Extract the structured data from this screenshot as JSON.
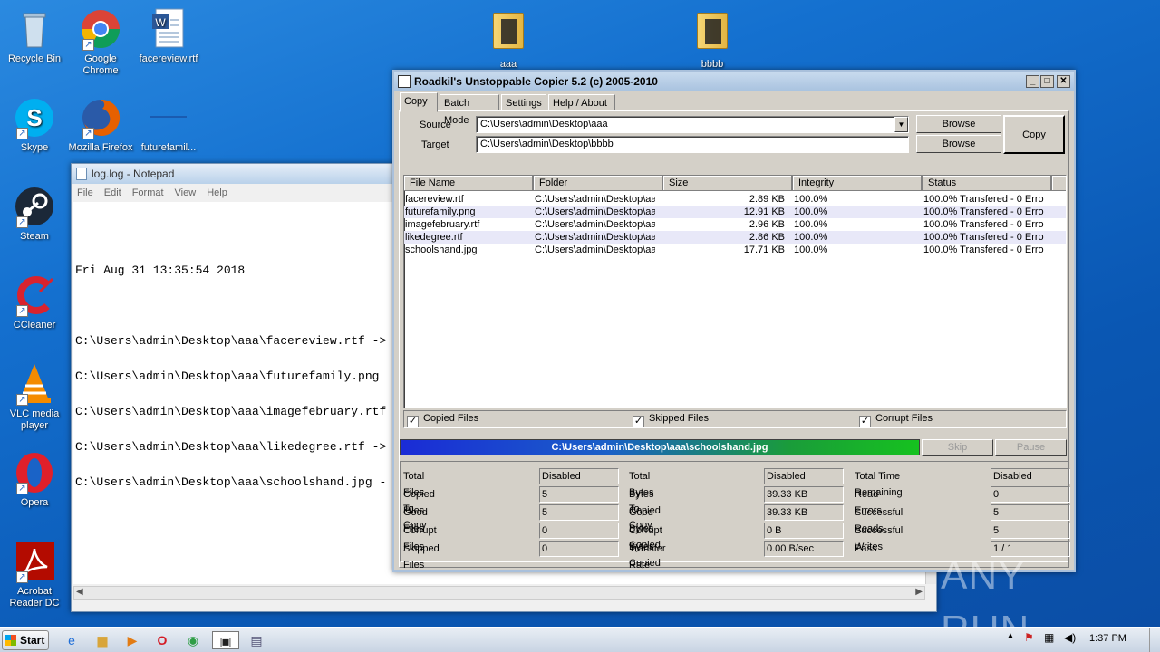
{
  "desktop_icons": [
    {
      "label": "Recycle Bin",
      "icon": "recycle-bin-icon"
    },
    {
      "label": "Google Chrome",
      "icon": "chrome-icon"
    },
    {
      "label": "facereview.rtf",
      "icon": "word-doc-icon"
    },
    {
      "label": "Skype",
      "icon": "skype-icon"
    },
    {
      "label": "Mozilla Firefox",
      "icon": "firefox-icon"
    },
    {
      "label": "futurefamil...",
      "icon": "image-file-icon"
    },
    {
      "label": "Steam",
      "icon": "steam-icon"
    },
    {
      "label": "CCleaner",
      "icon": "ccleaner-icon"
    },
    {
      "label": "VLC media player",
      "icon": "vlc-icon"
    },
    {
      "label": "Opera",
      "icon": "opera-icon"
    },
    {
      "label": "Acrobat Reader DC",
      "icon": "acrobat-icon"
    },
    {
      "label": "aaa",
      "icon": "folder-icon"
    },
    {
      "label": "bbbb",
      "icon": "folder-icon"
    }
  ],
  "notepad": {
    "title": "log.log - Notepad",
    "menu": [
      "File",
      "Edit",
      "Format",
      "View",
      "Help"
    ],
    "lines": [
      "",
      "Fri Aug 31 13:35:54 2018",
      "",
      "C:\\Users\\admin\\Desktop\\aaa\\facereview.rtf ->",
      "C:\\Users\\admin\\Desktop\\aaa\\futurefamily.png",
      "C:\\Users\\admin\\Desktop\\aaa\\imagefebruary.rtf",
      "C:\\Users\\admin\\Desktop\\aaa\\likedegree.rtf ->",
      "C:\\Users\\admin\\Desktop\\aaa\\schoolshand.jpg -"
    ]
  },
  "copier": {
    "title": "Roadkil's Unstoppable Copier 5.2 (c) 2005-2010",
    "tabs": [
      "Copy",
      "Batch Mode",
      "Settings",
      "Help / About"
    ],
    "source_label": "Source",
    "source_value": "C:\\Users\\admin\\Desktop\\aaa",
    "target_label": "Target",
    "target_value": "C:\\Users\\admin\\Desktop\\bbbb",
    "browse": "Browse",
    "copy": "Copy",
    "columns": [
      "File Name",
      "Folder",
      "Size",
      "Integrity",
      "Status"
    ],
    "rows": [
      [
        "facereview.rtf",
        "C:\\Users\\admin\\Desktop\\aaa",
        "2.89 KB",
        "100.0%",
        "100.0% Transfered - 0 Erro"
      ],
      [
        "futurefamily.png",
        "C:\\Users\\admin\\Desktop\\aaa",
        "12.91 KB",
        "100.0%",
        "100.0% Transfered - 0 Erro"
      ],
      [
        "imagefebruary.rtf",
        "C:\\Users\\admin\\Desktop\\aaa",
        "2.96 KB",
        "100.0%",
        "100.0% Transfered - 0 Erro"
      ],
      [
        "likedegree.rtf",
        "C:\\Users\\admin\\Desktop\\aaa",
        "2.86 KB",
        "100.0%",
        "100.0% Transfered - 0 Erro"
      ],
      [
        "schoolshand.jpg",
        "C:\\Users\\admin\\Desktop\\aaa",
        "17.71 KB",
        "100.0%",
        "100.0% Transfered - 0 Erro"
      ]
    ],
    "checks": {
      "copied": "Copied Files",
      "skipped": "Skipped Files",
      "corrupt": "Corrupt Files"
    },
    "progress_text": "C:\\Users\\admin\\Desktop\\aaa\\schoolshand.jpg",
    "progress_fraction": 1.0,
    "skip": "Skip",
    "pause": "Pause",
    "stats": {
      "col1": [
        [
          "Total Files To Copy",
          "Disabled"
        ],
        [
          "Copied Files",
          "5"
        ],
        [
          "Good Files",
          "5"
        ],
        [
          "Corrupt Files",
          "0"
        ],
        [
          "Skipped Files",
          "0"
        ]
      ],
      "col2": [
        [
          "Total Bytes To Copy",
          "Disabled"
        ],
        [
          "Bytes Copied",
          "39.33 KB"
        ],
        [
          "Good Bytes Copied",
          "39.33 KB"
        ],
        [
          "Corrupt Bytes Copied",
          "0 B"
        ],
        [
          "Transfer Rate",
          "0.00 B/sec"
        ]
      ],
      "col3": [
        [
          "Total Time Remaining",
          "Disabled"
        ],
        [
          "Read Errors",
          "0"
        ],
        [
          "Successful Reads",
          "5"
        ],
        [
          "Successful Writes",
          "5"
        ],
        [
          "Pass",
          "1 / 1"
        ]
      ]
    }
  },
  "watermark": "ANY RUN",
  "taskbar": {
    "start": "Start",
    "clock": "1:37 PM"
  }
}
